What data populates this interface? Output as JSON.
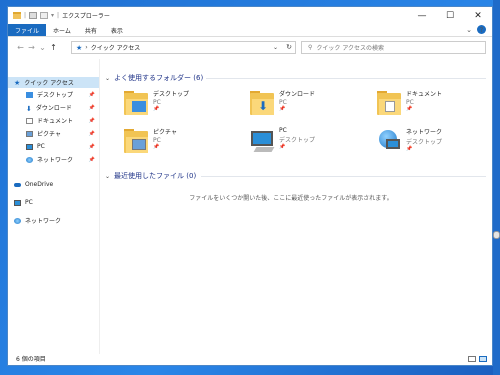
{
  "window": {
    "title": "エクスプローラー",
    "controls": {
      "minimize": "—",
      "maximize": "☐",
      "close": "✕"
    }
  },
  "ribbon": {
    "tabs": [
      {
        "label": "ファイル",
        "active": true
      },
      {
        "label": "ホーム"
      },
      {
        "label": "共有"
      },
      {
        "label": "表示"
      }
    ],
    "expand_icon": "⌄",
    "help_icon": "?"
  },
  "address": {
    "back": "←",
    "forward": "→",
    "recent": "⌄",
    "up": "↑",
    "location_icon": "★",
    "separator": "›",
    "path": "クイック アクセス",
    "dropdown": "⌄",
    "refresh": "↻"
  },
  "search": {
    "icon": "⚲",
    "placeholder": "クイック アクセスの検索"
  },
  "sidebar": {
    "quick_access": "クイック アクセス",
    "items": [
      {
        "label": "デスクトップ",
        "pin": "📌"
      },
      {
        "label": "ダウンロード",
        "pin": "📌"
      },
      {
        "label": "ドキュメント",
        "pin": "📌"
      },
      {
        "label": "ピクチャ",
        "pin": "📌"
      },
      {
        "label": "PC",
        "pin": "📌"
      },
      {
        "label": "ネットワーク",
        "pin": "📌"
      }
    ],
    "onedrive": "OneDrive",
    "pc": "PC",
    "network": "ネットワーク"
  },
  "main": {
    "frequent_header": "よく使用するフォルダー (6)",
    "recent_header": "最近使用したファイル (0)",
    "empty_message": "ファイルをいくつか開いた後、ここに最近使ったファイルが表示されます。",
    "folders": [
      {
        "name": "デスクトップ",
        "sub": "PC",
        "pin": "📌",
        "icon": "desktop-folder"
      },
      {
        "name": "ダウンロード",
        "sub": "PC",
        "pin": "📌",
        "icon": "downloads-folder"
      },
      {
        "name": "ドキュメント",
        "sub": "PC",
        "pin": "📌",
        "icon": "documents-folder"
      },
      {
        "name": "ピクチャ",
        "sub": "PC",
        "pin": "📌",
        "icon": "pictures-folder"
      },
      {
        "name": "PC",
        "sub": "デスクトップ",
        "pin": "📌",
        "icon": "pc"
      },
      {
        "name": "ネットワーク",
        "sub": "デスクトップ",
        "pin": "📌",
        "icon": "network"
      }
    ]
  },
  "status": {
    "count": "6 個の項目"
  },
  "colors": {
    "accent": "#1a6bc0",
    "selected": "#cce4f7",
    "header": "#1e3287",
    "folder": "#f1c454"
  }
}
